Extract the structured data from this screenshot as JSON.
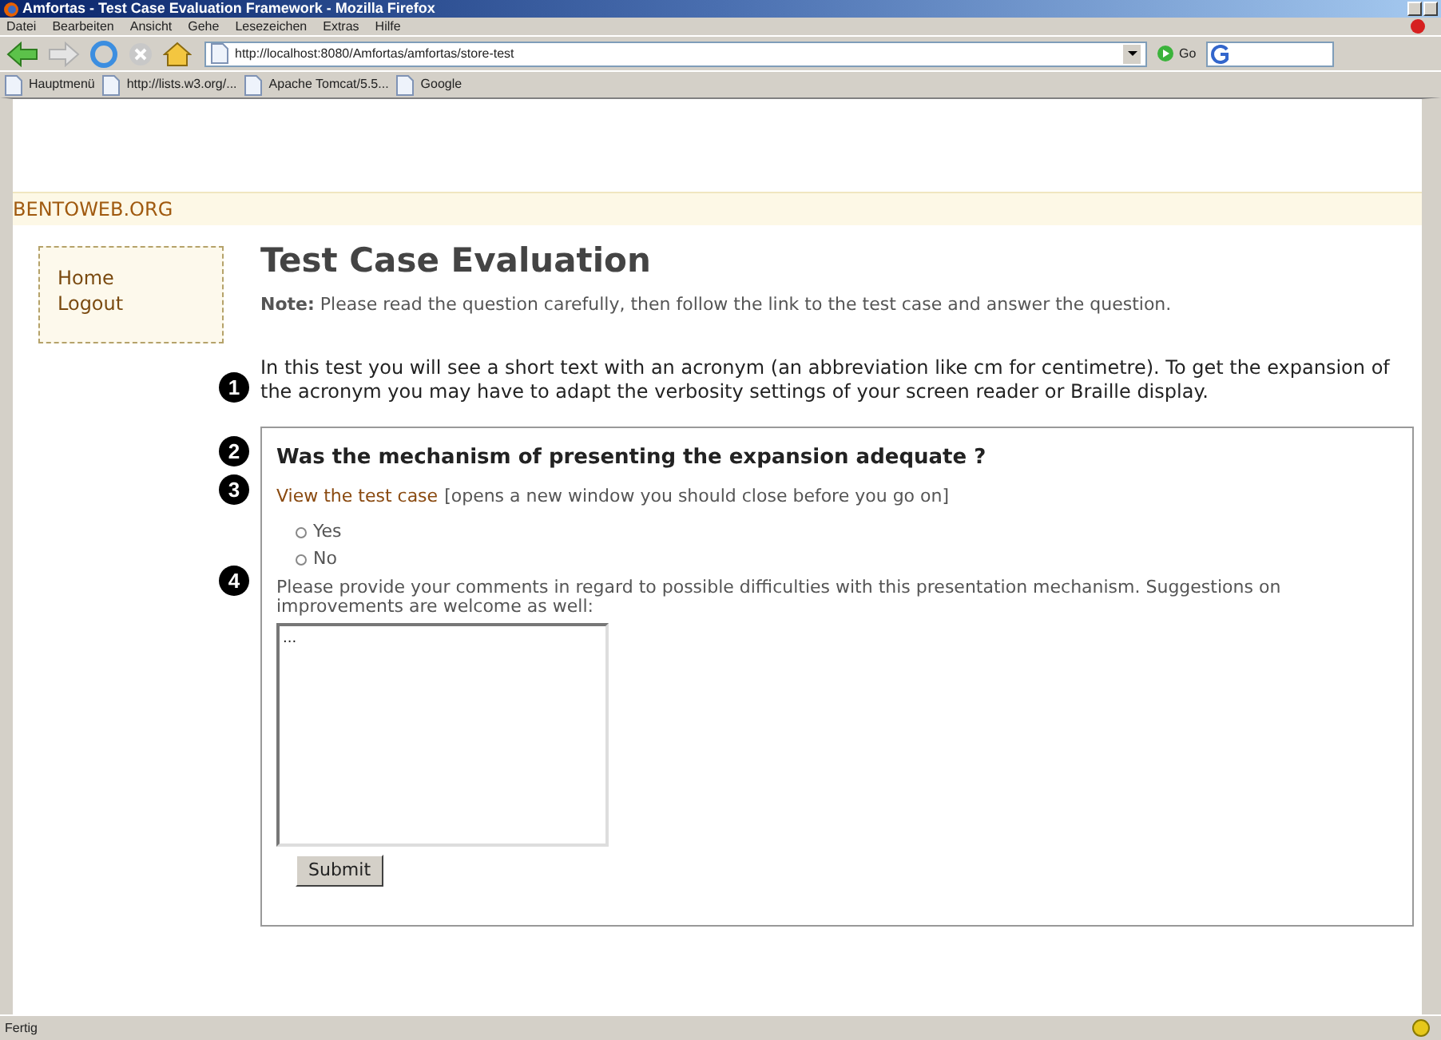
{
  "window": {
    "title": "Amfortas - Test Case Evaluation Framework - Mozilla Firefox"
  },
  "menu": [
    "Datei",
    "Bearbeiten",
    "Ansicht",
    "Gehe",
    "Lesezeichen",
    "Extras",
    "Hilfe"
  ],
  "address_bar": {
    "value": "http://localhost:8080/Amfortas/amfortas/store-test",
    "go_label": "Go"
  },
  "bookmarks": [
    "Hauptmenü",
    "http://lists.w3.org/...",
    "Apache Tomcat/5.5...",
    "Google"
  ],
  "site": {
    "name": "BENTOWEB.ORG"
  },
  "sidebar": {
    "items": [
      "Home",
      "Logout"
    ]
  },
  "heading": "Test Case Evaluation",
  "note": "**Note:** Please read the question carefully, then follow the link to the test case and answer the question.",
  "intro": {
    "marker": "1",
    "text": "In this test you will see a short text with an acronym (an abbreviation like cm for centimetre). To get the expansion of the acronym you may have to adapt the verbosity settings of your screen reader or Braille display."
  },
  "question": {
    "marker": "2",
    "text": "Was the mechanism of presenting the expansion adequate ?"
  },
  "test_link": {
    "marker": "3",
    "label": "View the test case",
    "hint": "[opens a new window you should close before you go on]"
  },
  "options": [
    {
      "label": "Yes",
      "selected": false
    },
    {
      "label": "No",
      "selected": false
    }
  ],
  "comments": {
    "marker": "4",
    "prompt": "Please provide your comments in regard to possible difficulties with this presentation mechanism. Suggestions on improvements are welcome as well:",
    "value": "..."
  },
  "submit": "Submit",
  "status_bar": {
    "text": "Fertig"
  }
}
